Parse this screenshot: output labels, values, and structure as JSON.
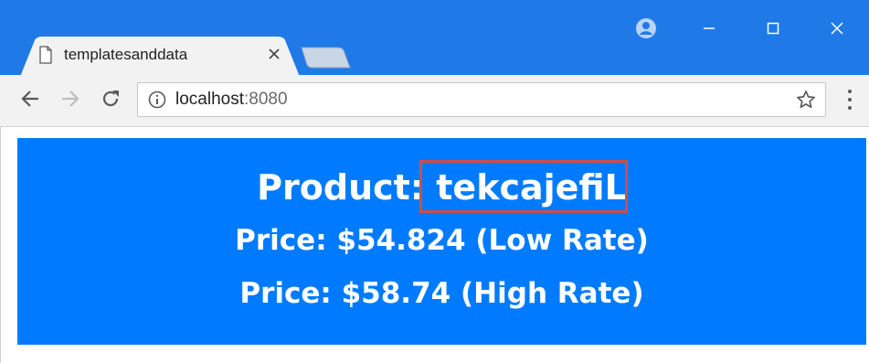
{
  "browser": {
    "tab_title": "templatesanddata",
    "url_host": "localhost",
    "url_port": ":8080",
    "icons": {
      "back": "arrow-left-icon",
      "forward": "arrow-right-icon",
      "reload": "reload-icon",
      "info": "info-icon",
      "bookmark": "star-icon",
      "menu": "kebab-menu-icon",
      "profile": "profile-icon",
      "minimize": "minimize-icon",
      "maximize": "maximize-icon",
      "close": "close-icon"
    },
    "colors": {
      "titlebar": "#1f7ae8",
      "toolbar": "#f2f2f2"
    }
  },
  "content": {
    "product_prefix": "Product:",
    "product_name": "tekcajefiL",
    "price_low": "Price: $54.824 (Low Rate)",
    "price_high": "Price: $58.74 (High Rate)",
    "colors": {
      "banner": "#007bff",
      "highlight_border": "#d24b4b",
      "text": "#ffffff"
    }
  }
}
